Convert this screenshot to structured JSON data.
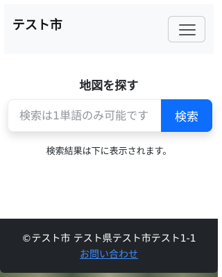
{
  "navbar": {
    "brand": "テスト市",
    "toggler_icon": "hamburger-menu-icon"
  },
  "main": {
    "heading": "地図を探す",
    "search": {
      "placeholder": "検索は1単語のみ可能です",
      "value": "",
      "button_label": "検索"
    },
    "result_text": "検索結果は下に表示されます。"
  },
  "footer": {
    "copyright": "©テスト市 テスト県テスト市テスト1-1",
    "contact_link": "お問い合わせ"
  },
  "colors": {
    "navbar_bg": "#f8f9fa",
    "primary": "#0d6efd",
    "footer_bg": "#212529",
    "link": "#3d8bfd"
  }
}
